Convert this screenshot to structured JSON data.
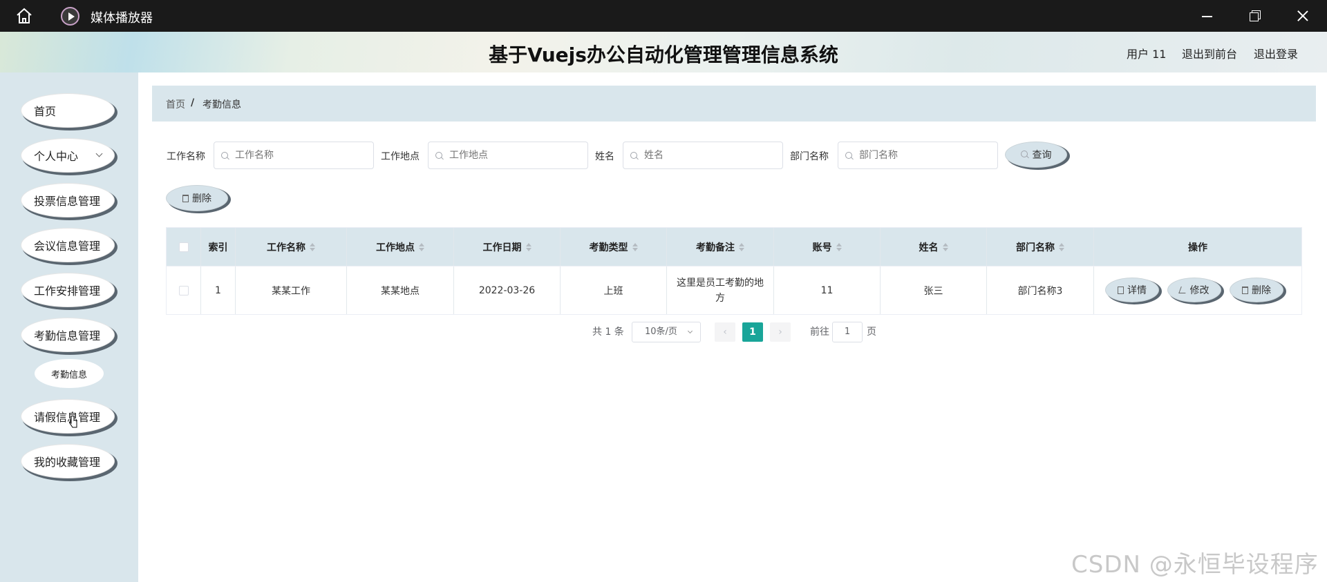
{
  "titlebar": {
    "title": "媒体播放器"
  },
  "header": {
    "system_title": "基于Vuejs办公自动化管理管理信息系统",
    "user_label": "用户 11",
    "front_link": "退出到前台",
    "logout_link": "退出登录"
  },
  "sidebar": {
    "items": [
      {
        "label": "首页"
      },
      {
        "label": "个人中心"
      },
      {
        "label": "投票信息管理"
      },
      {
        "label": "会议信息管理"
      },
      {
        "label": "工作安排管理"
      },
      {
        "label": "考勤信息管理"
      },
      {
        "label": "请假信息管理"
      },
      {
        "label": "我的收藏管理"
      }
    ],
    "sub_item": "考勤信息"
  },
  "breadcrumb": {
    "home": "首页",
    "separator": "/",
    "current": "考勤信息"
  },
  "filters": {
    "job_name": {
      "label": "工作名称",
      "placeholder": "工作名称"
    },
    "job_location": {
      "label": "工作地点",
      "placeholder": "工作地点"
    },
    "name": {
      "label": "姓名",
      "placeholder": "姓名"
    },
    "dept": {
      "label": "部门名称",
      "placeholder": "部门名称"
    },
    "query_button": "查询"
  },
  "toolbar": {
    "delete_button": "删除"
  },
  "table": {
    "columns": [
      "索引",
      "工作名称",
      "工作地点",
      "工作日期",
      "考勤类型",
      "考勤备注",
      "账号",
      "姓名",
      "部门名称",
      "操作"
    ],
    "rows": [
      {
        "index": "1",
        "job_name": "某某工作",
        "job_location": "某某地点",
        "date": "2022-03-26",
        "type": "上班",
        "note": "这里是员工考勤的地方",
        "account": "11",
        "name": "张三",
        "dept": "部门名称3",
        "actions": {
          "detail": "详情",
          "edit": "修改",
          "delete": "删除"
        }
      }
    ]
  },
  "pagination": {
    "total": "共 1 条",
    "page_size": "10条/页",
    "prev": "‹",
    "current_page": "1",
    "next": "›",
    "goto_prefix": "前往",
    "goto_value": "1",
    "goto_suffix": "页"
  },
  "watermark": "CSDN @永恒毕设程序",
  "colors": {
    "accent": "#19a599",
    "sidebar_bg": "#d9e6ec",
    "titlebar_bg": "#1a1a1a"
  }
}
